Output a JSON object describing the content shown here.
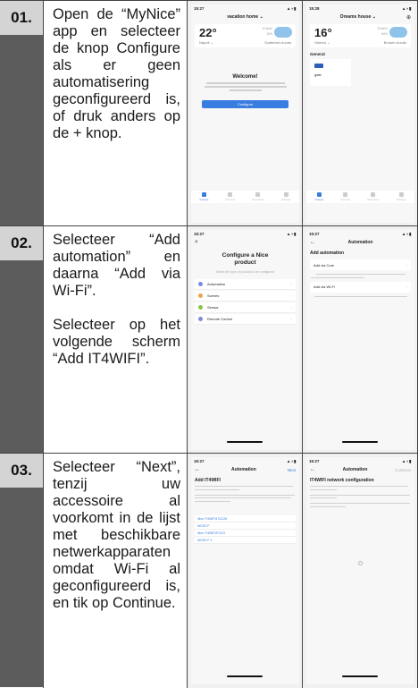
{
  "steps": [
    {
      "number": "01.",
      "paragraphs": [
        "Open de “MyNice” app en selecteer de knop Configure als er geen automatisering geconfigureerd is, of druk anders op de + knop."
      ],
      "screens": {
        "left": {
          "time": "15:27",
          "signal": "▲◗▮",
          "header": "vacation home ⌄",
          "weather": {
            "temp": "22°",
            "city": "Napoli ⌄",
            "condition": "Scattered clouds",
            "stat1": "12 km/h",
            "stat2": "15%"
          },
          "welcome": "Welcome!",
          "button": "Configure",
          "tabs": [
            "Groups",
            "Devices",
            "Scenarios",
            "Settings"
          ]
        },
        "right": {
          "time": "15:28",
          "signal": "▲◗▮",
          "header": "Dreams house ⌄",
          "header_right": "⊕",
          "weather": {
            "temp": "16°",
            "city": "Oderzo ⌄",
            "condition": "Broken clouds",
            "stat1": "19 km/h",
            "stat2": "60%"
          },
          "section": "General",
          "card": "gate",
          "tabs": [
            "Groups",
            "Devices",
            "Scenarios",
            "Settings"
          ]
        }
      }
    },
    {
      "number": "02.",
      "paragraphs": [
        "Selecteer “Add automation” en daarna “Add via Wi-Fi”.",
        "Selecteer op het volgende scherm “Add IT4WIFI”."
      ],
      "screens": {
        "left": {
          "time": "15:27",
          "signal": "▲◗▮",
          "close": "×",
          "title": "Configure a Nice product",
          "subtitle": "Select the type of product to be configured",
          "items": [
            {
              "letter": "A",
              "label": "Automation",
              "color": "#7b8cde"
            },
            {
              "letter": "S",
              "label": "Scenes",
              "color": "#f0a24a"
            },
            {
              "letter": "S",
              "label": "Sensor",
              "color": "#8bc34a"
            },
            {
              "letter": "R",
              "label": "Remote Control",
              "color": "#7b8cde"
            }
          ]
        },
        "right": {
          "time": "15:27",
          "signal": "▲◗▮",
          "back": "←",
          "header": "Automation",
          "pagetitle": "Add automation",
          "card1": "Add via Core",
          "card2": "Add via Wi-Fi",
          "chev": "›"
        }
      }
    },
    {
      "number": "03.",
      "paragraphs": [
        "Selecteer “Next”, tenzij uw accessoire al voorkomt in de lijst met beschikbare netwerkapparaten omdat Wi-Fi al geconfigureerd is, en tik op Continue."
      ],
      "screens": {
        "left": {
          "time": "15:27",
          "signal": "▲◗▮",
          "back": "←",
          "header": "Automation",
          "next": "Next",
          "pagetitle": "Add IT4WIFI",
          "networks": [
            "Nice IT4WIFI47AC26",
            "NICE0 P",
            "Nice IT4WIFI2F3C9",
            "NICE0 P 1"
          ]
        },
        "right": {
          "time": "15:27",
          "signal": "▲◗▮",
          "back": "←",
          "header": "Automation",
          "continue": "Continue",
          "pagetitle": "IT4WIFI network configuration"
        }
      }
    }
  ]
}
